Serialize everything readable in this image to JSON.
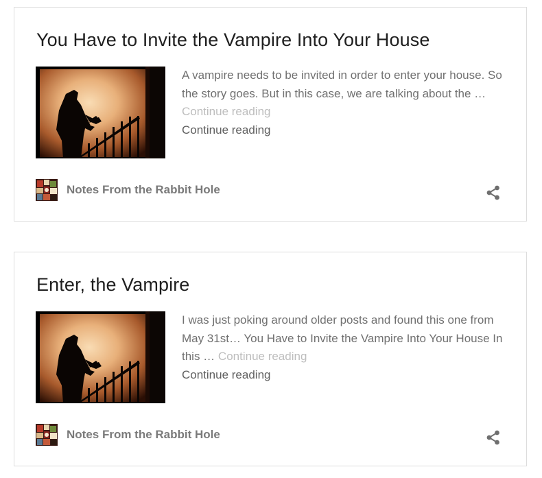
{
  "posts": [
    {
      "title": "You Have to Invite the Vampire Into Your House",
      "excerpt": "A vampire needs to be invited in order to enter your house. So the story goes. But in this case, we are talking about the …",
      "continue_faded": "Continue reading",
      "continue_link": "Continue reading",
      "author": "Notes From the Rabbit Hole"
    },
    {
      "title": "Enter, the Vampire",
      "excerpt": "I was just poking around older posts and found this one from May 31st… You Have to Invite the Vampire Into Your House In this …",
      "continue_faded": "Continue reading",
      "continue_link": "Continue reading",
      "author": "Notes From the Rabbit Hole"
    }
  ],
  "icons": {
    "share": "share-icon"
  },
  "colors": {
    "title": "#1f1f1f",
    "excerpt": "#707070",
    "faded_link": "#bdbdbd",
    "author": "#7a7a7a",
    "border": "#dcdcdc"
  }
}
